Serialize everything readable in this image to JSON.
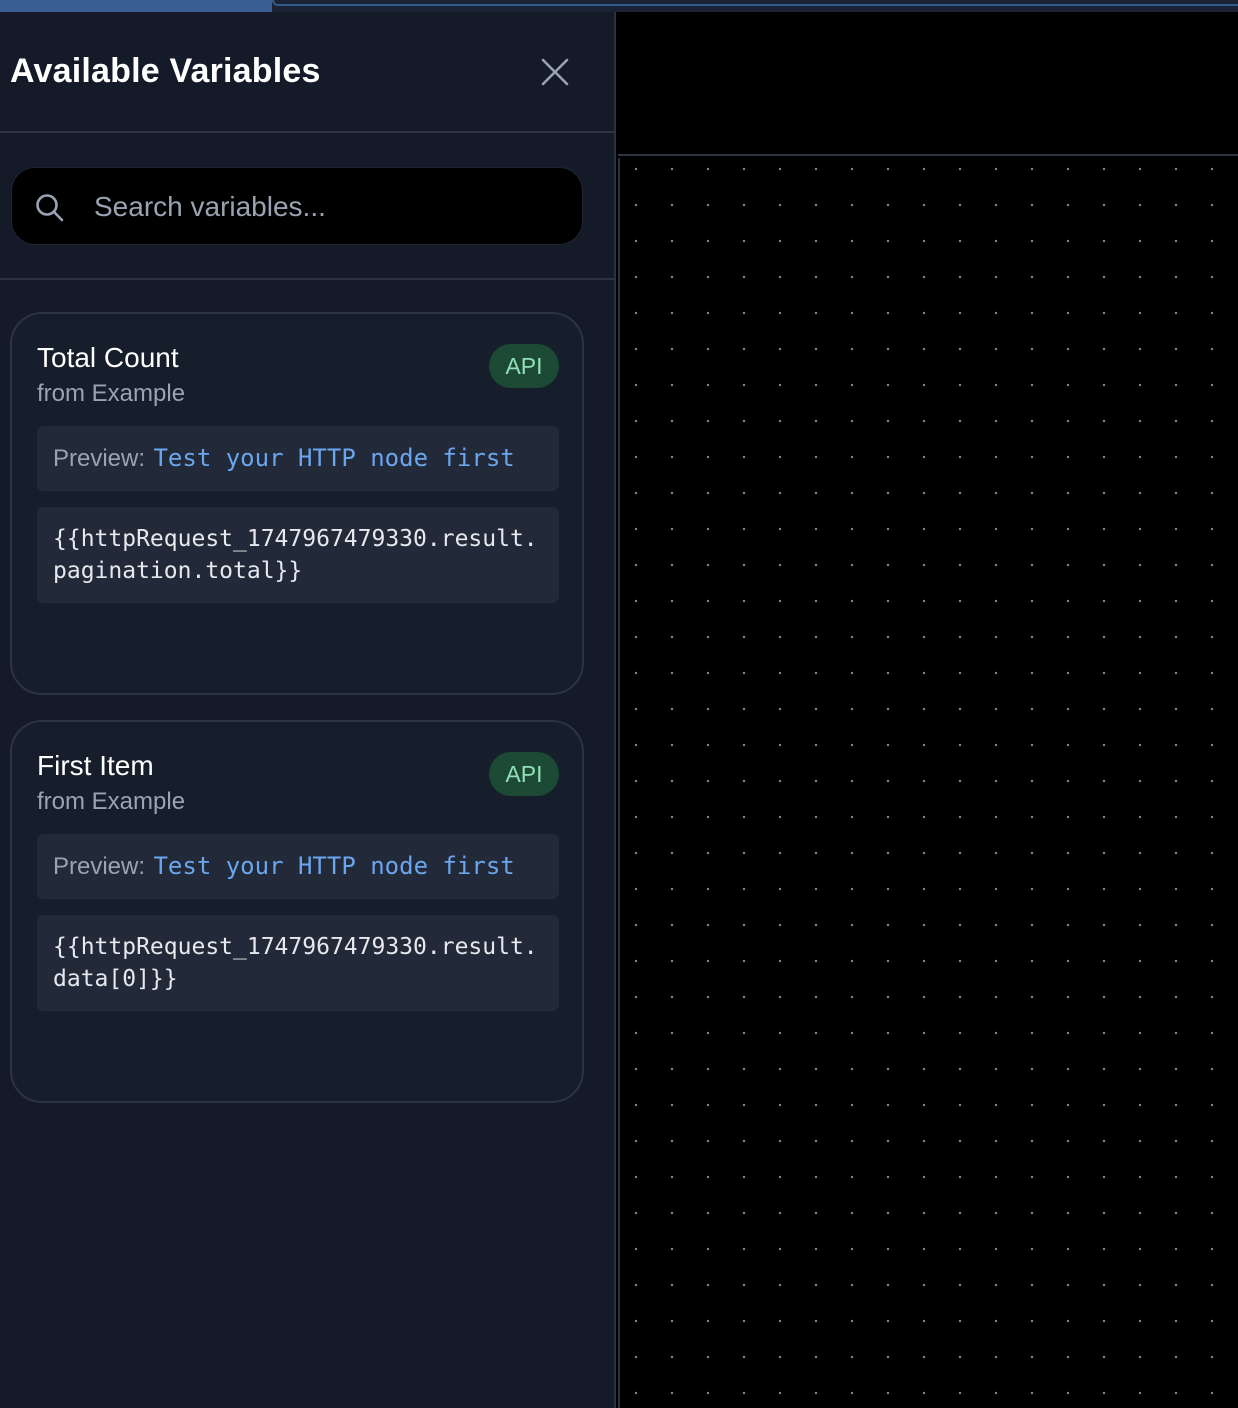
{
  "panel": {
    "title": "Available Variables",
    "search": {
      "placeholder": "Search variables...",
      "value": ""
    },
    "variables": [
      {
        "title": "Total Count",
        "source": "from Example",
        "badge": "API",
        "preview_label": "Preview:",
        "preview_value": "Test your HTTP node first",
        "expression": "{{httpRequest_1747967479330.result.pagination.total}}"
      },
      {
        "title": "First Item",
        "source": "from Example",
        "badge": "API",
        "preview_label": "Preview:",
        "preview_value": "Test your HTTP node first",
        "expression": "{{httpRequest_1747967479330.result.data[0]}}"
      }
    ]
  },
  "icons": {
    "close": "close-icon",
    "search": "search-icon"
  },
  "colors": {
    "panel_bg": "#141a27",
    "badge_bg": "#1d4a35",
    "badge_text": "#8fe0b4",
    "preview_value": "#6aa6ee",
    "canvas_bg": "#000000"
  }
}
